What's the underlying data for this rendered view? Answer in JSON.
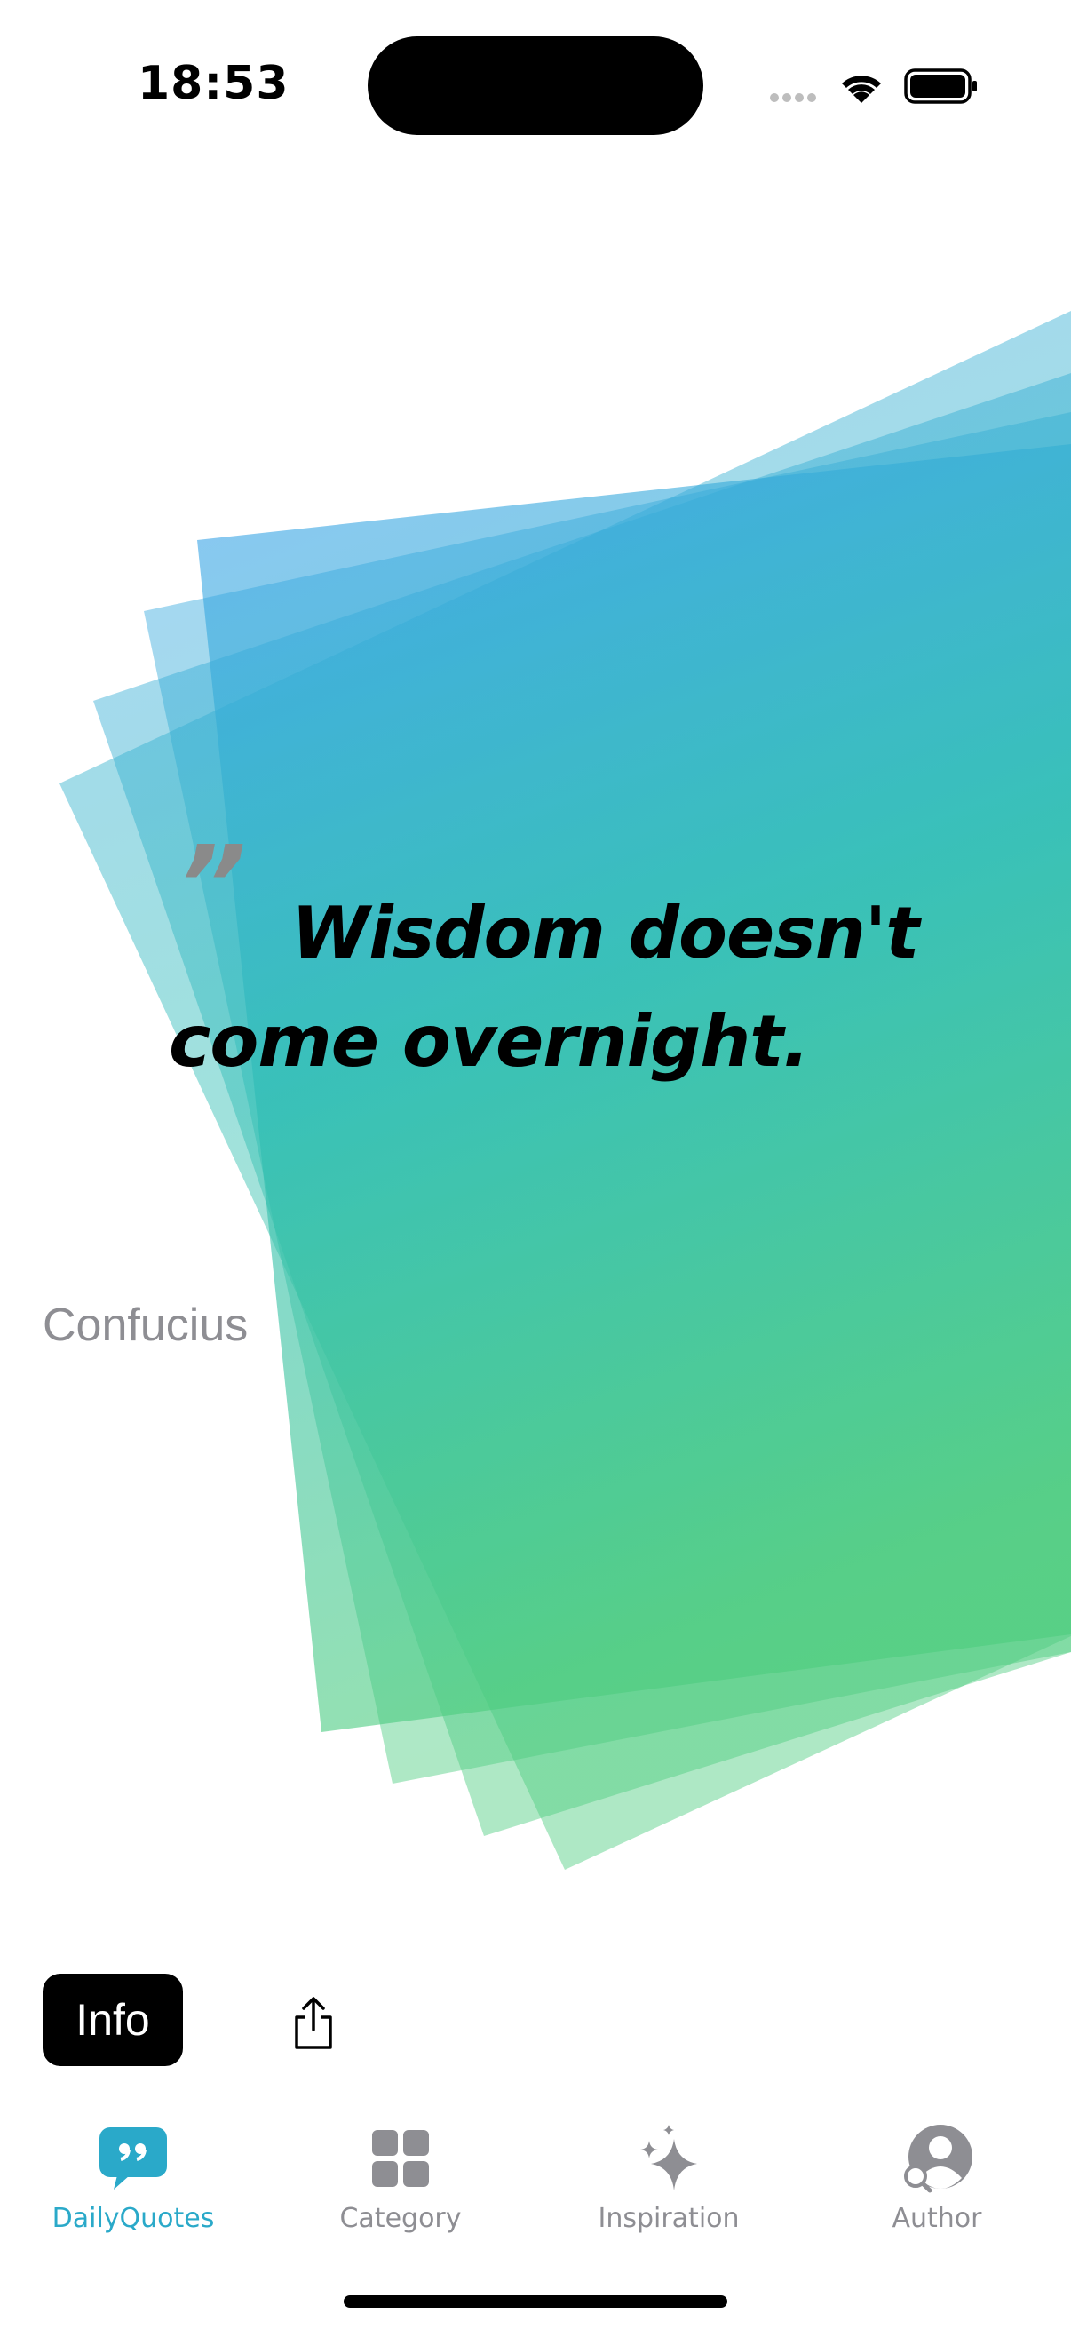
{
  "status_bar": {
    "time": "18:53",
    "icons": [
      "cellular-dots-icon",
      "wifi-icon",
      "battery-icon"
    ]
  },
  "quote": {
    "mark": "”",
    "text": "Wisdom doesn't come overnight.",
    "author": "Confucius"
  },
  "actions": {
    "info_label": "Info",
    "share_icon": "share-icon"
  },
  "tab_bar": {
    "tabs": [
      {
        "label": "DailyQuotes",
        "icon": "quote-bubble-icon",
        "active": true
      },
      {
        "label": "Category",
        "icon": "grid-icon",
        "active": false
      },
      {
        "label": "Inspiration",
        "icon": "sparkles-icon",
        "active": false
      },
      {
        "label": "Author",
        "icon": "person-search-icon",
        "active": false
      }
    ]
  },
  "colors": {
    "accent": "#2aa9c9",
    "card_top": "#3aa0ee",
    "card_bottom": "#4ccc7e",
    "inactive": "#8e8e93"
  }
}
